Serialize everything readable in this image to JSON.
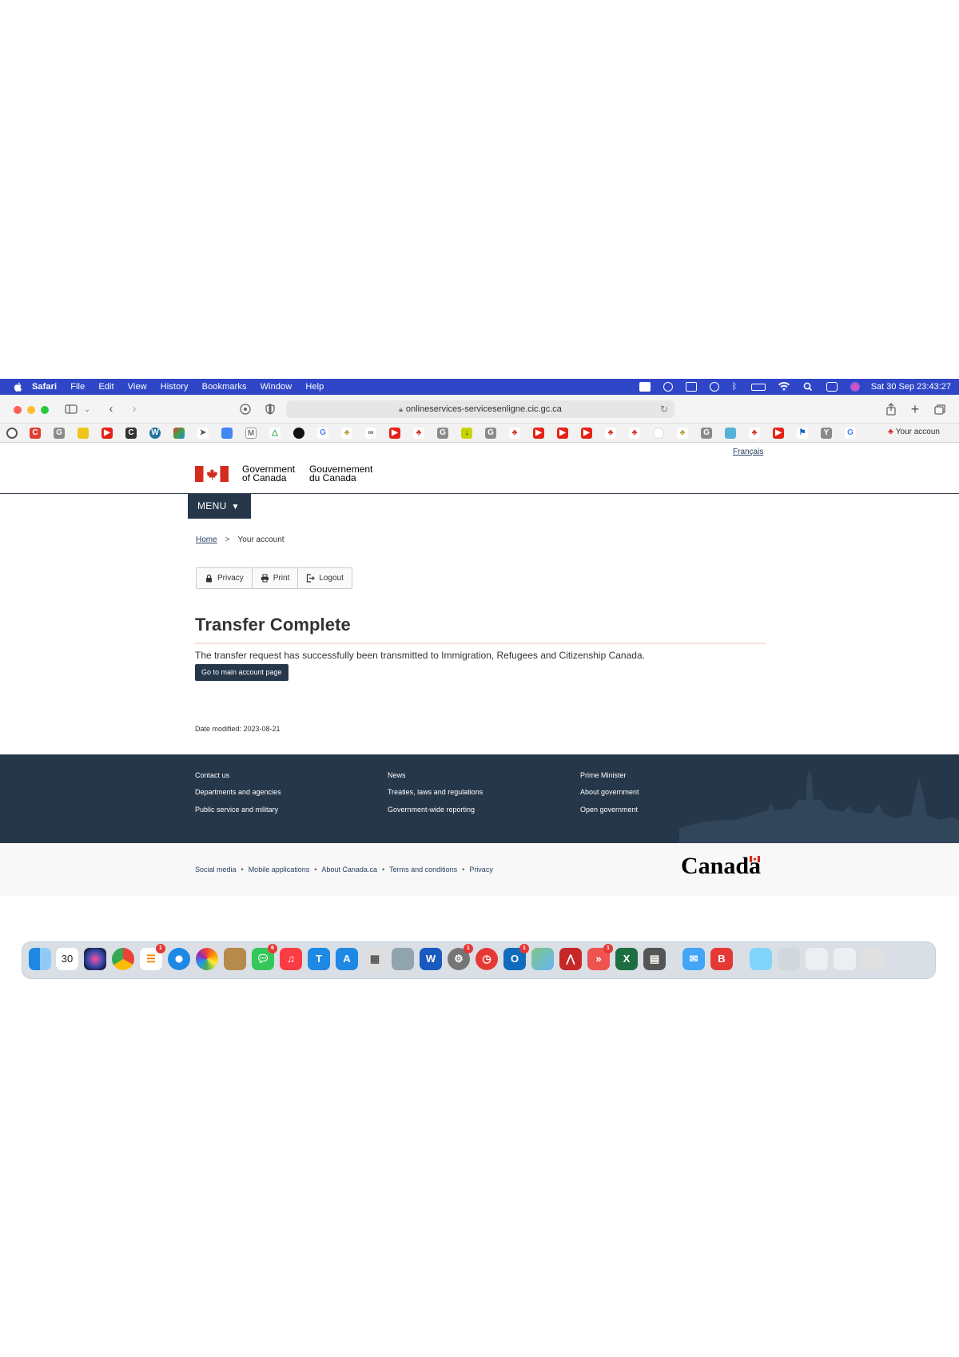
{
  "menubar": {
    "app": "Safari",
    "items": [
      "File",
      "Edit",
      "View",
      "History",
      "Bookmarks",
      "Window",
      "Help"
    ],
    "clock": "Sat 30 Sep  23:43:27"
  },
  "browser": {
    "url": "onlineservices-servicesenligne.cic.gc.ca",
    "favorites_account": "Your accoun"
  },
  "page": {
    "language_link": "Français",
    "signature_en_line1": "Government",
    "signature_en_line2": "of Canada",
    "signature_fr_line1": "Gouvernement",
    "signature_fr_line2": "du Canada",
    "menu_label": "MENU",
    "breadcrumb": {
      "home": "Home",
      "separator": ">",
      "current": "Your account"
    },
    "actions": {
      "privacy": "Privacy",
      "print": "Print",
      "logout": "Logout"
    },
    "title": "Transfer Complete",
    "message": "The transfer request has successfully been transmitted to Immigration, Refugees and Citizenship Canada.",
    "main_account_button": "Go to main account page",
    "date_modified": "Date modified: 2023-08-21"
  },
  "footer": {
    "col1": [
      "Contact us",
      "Departments and agencies",
      "Public service and military"
    ],
    "col2": [
      "News",
      "Treaties, laws and regulations",
      "Government-wide reporting"
    ],
    "col3": [
      "Prime Minister",
      "About government",
      "Open government"
    ],
    "sub_links": [
      "Social media",
      "Mobile applications",
      "About Canada.ca",
      "Terms and conditions",
      "Privacy"
    ],
    "wordmark": "Canada"
  },
  "dock": {
    "calendar_day": "30",
    "badges": {
      "reminders": "1",
      "messages": "6",
      "settings": "1",
      "outlook": "1",
      "speedtest": "1"
    }
  },
  "colors": {
    "menubar": "#2f46c9",
    "goc_dark": "#26374a",
    "link": "#284162",
    "flag_red": "#d52b1e"
  }
}
